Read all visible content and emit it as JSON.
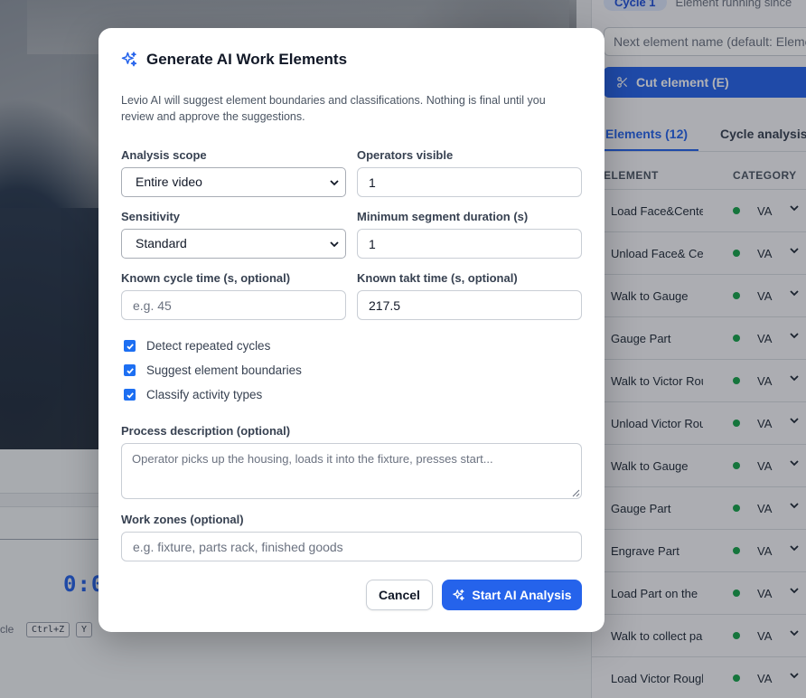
{
  "background": {
    "timecode": "0:0",
    "shortcut_label": "cle",
    "shortcut_keys": [
      "Ctrl+Z",
      "Y"
    ],
    "cycle_pill": "Cycle 1",
    "cycle_status": "Element running since",
    "next_element_placeholder": "Next element name (default: Element",
    "cut_button": "Cut element (E)",
    "tabs": {
      "elements": "Elements (12)",
      "cycle_analysis": "Cycle analysis"
    },
    "table_headers": {
      "element": "ELEMENT",
      "category": "CATEGORY"
    },
    "status_color": "#16a34a",
    "elements": [
      {
        "name": "Load Face&Center",
        "category": "VA"
      },
      {
        "name": "Unload Face& Center",
        "category": "VA"
      },
      {
        "name": "Walk to Gauge",
        "category": "VA"
      },
      {
        "name": "Gauge Part",
        "category": "VA"
      },
      {
        "name": "Walk to Victor Rough",
        "category": "VA"
      },
      {
        "name": "Unload Victor Rough",
        "category": "VA"
      },
      {
        "name": "Walk to Gauge",
        "category": "VA"
      },
      {
        "name": "Gauge Part",
        "category": "VA"
      },
      {
        "name": "Engrave Part",
        "category": "VA"
      },
      {
        "name": "Load Part on the",
        "category": "VA"
      },
      {
        "name": "Walk to collect part",
        "category": "VA"
      },
      {
        "name": "Load Victor Rough",
        "category": "VA"
      }
    ]
  },
  "modal": {
    "title": "Generate AI Work Elements",
    "description": "Levio AI will suggest element boundaries and classifications. Nothing is final until you review and approve the suggestions.",
    "analysis_scope": {
      "label": "Analysis scope",
      "value": "Entire video"
    },
    "operators_visible": {
      "label": "Operators visible",
      "value": "1"
    },
    "sensitivity": {
      "label": "Sensitivity",
      "value": "Standard"
    },
    "min_segment": {
      "label": "Minimum segment duration (s)",
      "value": "1"
    },
    "cycle_time": {
      "label": "Known cycle time (s, optional)",
      "placeholder": "e.g. 45"
    },
    "takt_time": {
      "label": "Known takt time (s, optional)",
      "value": "217.5"
    },
    "checkboxes": [
      {
        "label": "Detect repeated cycles",
        "checked": true
      },
      {
        "label": "Suggest element boundaries",
        "checked": true
      },
      {
        "label": "Classify activity types",
        "checked": true
      }
    ],
    "process_description": {
      "label": "Process description (optional)",
      "placeholder": "Operator picks up the housing, loads it into the fixture, presses start..."
    },
    "work_zones": {
      "label": "Work zones (optional)",
      "placeholder": "e.g. fixture, parts rack, finished goods"
    },
    "cancel": "Cancel",
    "start": "Start AI Analysis",
    "accent": "#2563eb"
  }
}
